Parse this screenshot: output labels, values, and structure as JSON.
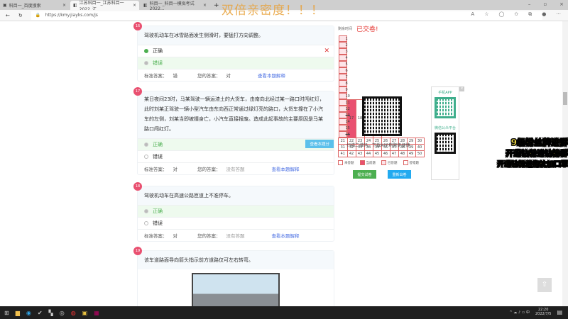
{
  "browser": {
    "tabs": [
      {
        "title": "科目一_百度搜索"
      },
      {
        "title": "江苏科目一_江苏科目一2022_江..."
      },
      {
        "title": "科目一_科目一模拟考试2022..."
      }
    ],
    "url": "https://kmy.jiayks.com/js",
    "new_tab": "+"
  },
  "overlay": {
    "top_text": "双倍亲密度！！！",
    "promo": [
      "9级粉丝牌进群",
      "开通钻粉进钻粉群",
      "开通钻粉送抱枕加口罩"
    ]
  },
  "questions": [
    {
      "num": "16",
      "text": "驾驶机动车在冰雪路面发生侧滑时，要猛打方向调整。",
      "options": [
        "正确",
        "错误"
      ],
      "standard_label": "标准答案：",
      "standard": "错",
      "yours_label": "您的答案：",
      "yours": "对",
      "explain": "查看本题解释"
    },
    {
      "num": "17",
      "text": "某日夜间23时，马某驾驶一辆运渣土的大货车，由南向北经过某一路口时闯红灯，此时刘某正驾驶一辆小型汽车由东向西正常通过绿灯亮的路口，大货车撞在了小汽车的左侧，刘某当即被撞身亡，小汽车直接报废。造成此起事故的主要原因是马某路口闯红灯。",
      "options": [
        "正确",
        "错误"
      ],
      "tip_button": "查看本题分",
      "standard_label": "标准答案：",
      "standard": "对",
      "yours_label": "您的答案：",
      "yours": "没有答题",
      "explain": "查看本题解释"
    },
    {
      "num": "18",
      "text": "驾驶机动车在高速公路匝道上不准停车。",
      "options": [
        "正确",
        "错误"
      ],
      "standard_label": "标准答案：",
      "standard": "对",
      "yours_label": "您的答案：",
      "yours": "没有答题",
      "explain": "查看本题解释"
    },
    {
      "num": "19",
      "text": "该车道路面导向箭头指示前方道路仅可左右转弯。"
    }
  ],
  "sidebar": {
    "timer_label": "剩余时间",
    "status": "已交卷!",
    "answered_upto": 16,
    "current": 17,
    "wrong": [
      13,
      16
    ],
    "legend": [
      "未答题",
      "当前题",
      "已答题",
      "答错题"
    ],
    "submit": "提交试卷",
    "reset": "重新出卷",
    "scan_text": "扫描二维码，下载APP刷题更便捷",
    "app_label": "手机APP",
    "wechat_label": "微信公众平台",
    "close": "×"
  },
  "taskbar": {
    "time": "22:20",
    "date": "2022/7/5"
  },
  "colors": {
    "accent": "#e95070",
    "green": "#4caf50",
    "blue": "#22aaf0"
  }
}
